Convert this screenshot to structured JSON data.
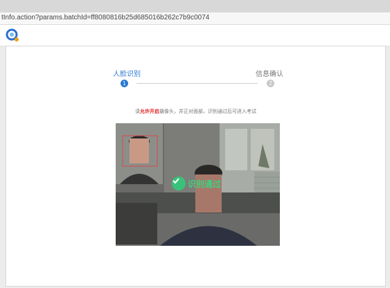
{
  "browser": {
    "url": "tInfo.action?params.batchId=ff8080816b25d685016b262c7b9c0074"
  },
  "steps": [
    {
      "number": "1",
      "label": "人脸识别"
    },
    {
      "number": "2",
      "label": "信息确认"
    }
  ],
  "instruction": {
    "prefix": "请",
    "highlight": "允许开启",
    "suffix": "摄像头，并正对面部，识别通过后可进入考试"
  },
  "camera": {
    "status_text": "识别通过"
  },
  "colors": {
    "accent": "#2b7ad0",
    "success": "#39c27a",
    "warning": "#e02020"
  }
}
